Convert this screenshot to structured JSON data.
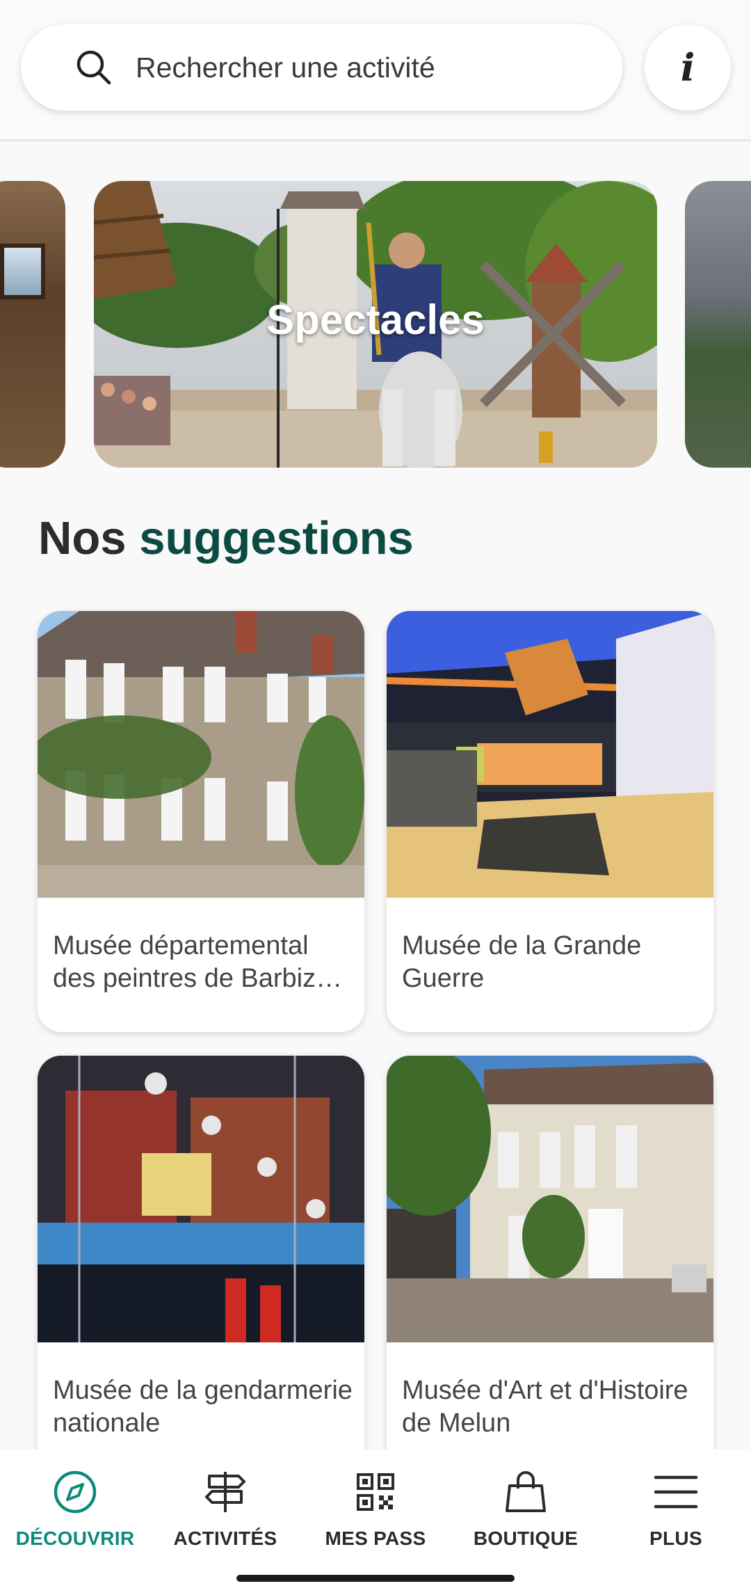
{
  "search": {
    "placeholder": "Rechercher une activité",
    "icon": "search-icon"
  },
  "info_button": {
    "label": "i",
    "icon": "info-icon"
  },
  "carousel": {
    "slides": [
      {
        "title": ""
      },
      {
        "title": "Spectacles"
      },
      {
        "title": ""
      }
    ]
  },
  "section": {
    "title_prefix": "Nos",
    "title_accent": "suggestions",
    "accent_color": "#0b4b43"
  },
  "cards": [
    {
      "title": "Musée départemental des peintres de Barbiz…"
    },
    {
      "title": "Musée de la Grande Guerre"
    },
    {
      "title": "Musée de la gendarmerie nationale"
    },
    {
      "title": "Musée d'Art et d'Histoire de Melun"
    }
  ],
  "bottom_nav": {
    "active_color": "#0d8a7c",
    "items": [
      {
        "label": "DÉCOUVRIR",
        "icon": "compass-icon",
        "active": true
      },
      {
        "label": "ACTIVITÉS",
        "icon": "signpost-icon",
        "active": false
      },
      {
        "label": "MES PASS",
        "icon": "qr-code-icon",
        "active": false
      },
      {
        "label": "BOUTIQUE",
        "icon": "shopping-bag-icon",
        "active": false
      },
      {
        "label": "PLUS",
        "icon": "menu-icon",
        "active": false
      }
    ]
  }
}
